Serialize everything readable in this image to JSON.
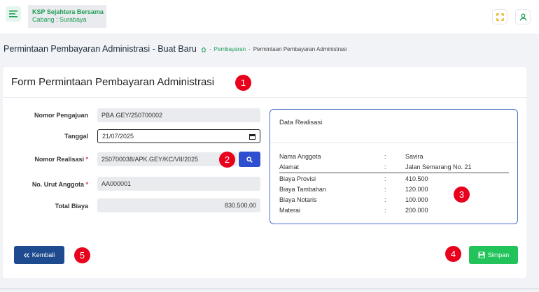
{
  "topbar": {
    "org_name": "KSP Sejahtera Bersama",
    "branch": "Cabang : Surabaya"
  },
  "page": {
    "heading": "Permintaan Pembayaran Administrasi - Buat Baru",
    "breadcrumb": {
      "home_icon": "home-icon",
      "link": "Pembayaran",
      "separator": "-",
      "current": "Permintaan Pembayaran Administrasi"
    }
  },
  "form": {
    "title": "Form Permintaan Pembayaran Administrasi",
    "fields": {
      "nomor_pengajuan": {
        "label": "Nomor Pengajuan",
        "value": "PBA.GEY/250700002"
      },
      "tanggal": {
        "label": "Tanggal",
        "value": "21/07/2025"
      },
      "nomor_realisasi": {
        "label": "Nomor Realisasi",
        "required_mark": "*",
        "value": "250700038/APK.GEY/KC/VII/2025"
      },
      "no_urut_anggota": {
        "label": "No. Urut Anggota",
        "required_mark": "*",
        "value": "AA000001"
      },
      "total_biaya": {
        "label": "Total Biaya",
        "value": "830.500,00"
      }
    }
  },
  "realisasi": {
    "title": "Data Realisasi",
    "rows": [
      {
        "key": "Nama Anggota",
        "colon": ":",
        "value": "Savira"
      },
      {
        "key": "Alamat",
        "colon": ":",
        "value": "Jalan Semarang No. 21"
      },
      {
        "key": "Biaya Provisi",
        "colon": ":",
        "value": "410.500"
      },
      {
        "key": "Biaya Tambahan",
        "colon": ":",
        "value": "120.000"
      },
      {
        "key": "Biaya Notaris",
        "colon": ":",
        "value": "100.000"
      },
      {
        "key": "Materai",
        "colon": ":",
        "value": "200.000"
      }
    ]
  },
  "actions": {
    "back_label": "Kembali",
    "save_label": "Simpan"
  },
  "markers": [
    "1",
    "2",
    "3",
    "4",
    "5"
  ],
  "colors": {
    "brand_green": "#1f9d55",
    "primary_blue": "#2f4fd1",
    "back_button": "#1e4b8f",
    "save_button": "#21c35a",
    "marker_red": "#e8001c"
  }
}
